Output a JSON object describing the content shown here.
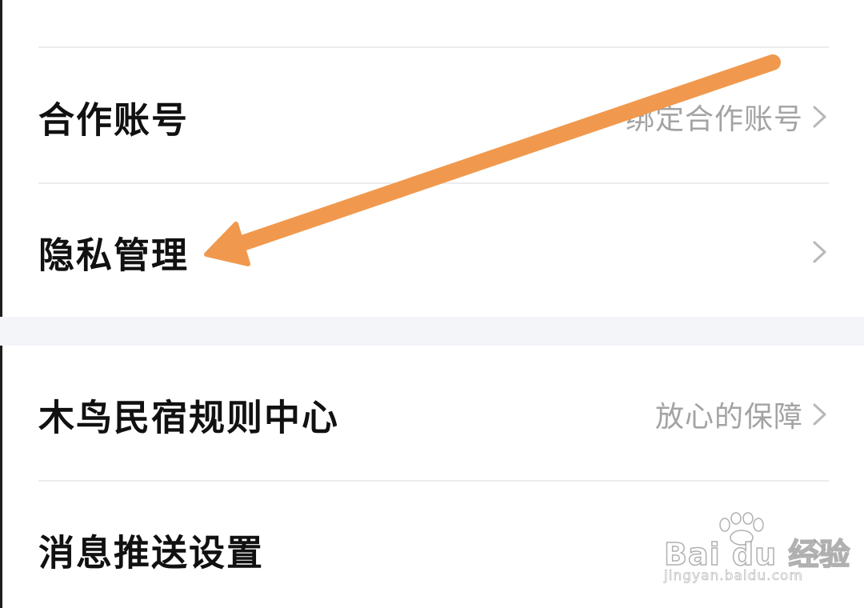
{
  "settings": {
    "rows": [
      {
        "label": "合作账号",
        "value": "绑定合作账号"
      },
      {
        "label": "隐私管理",
        "value": ""
      },
      {
        "label": "木鸟民宿规则中心",
        "value": "放心的保障"
      },
      {
        "label": "消息推送设置",
        "value": ""
      }
    ]
  },
  "annotation": {
    "arrow_color": "#F0994E",
    "target": "隐私管理"
  },
  "watermark": {
    "logo": "Bai du 经验",
    "url": "jingyan.baidu.com"
  },
  "icons": {
    "chevron": "chevron-right-icon",
    "arrow": "orange-arrow-annotation",
    "paw": "baidu-paw-logo"
  }
}
